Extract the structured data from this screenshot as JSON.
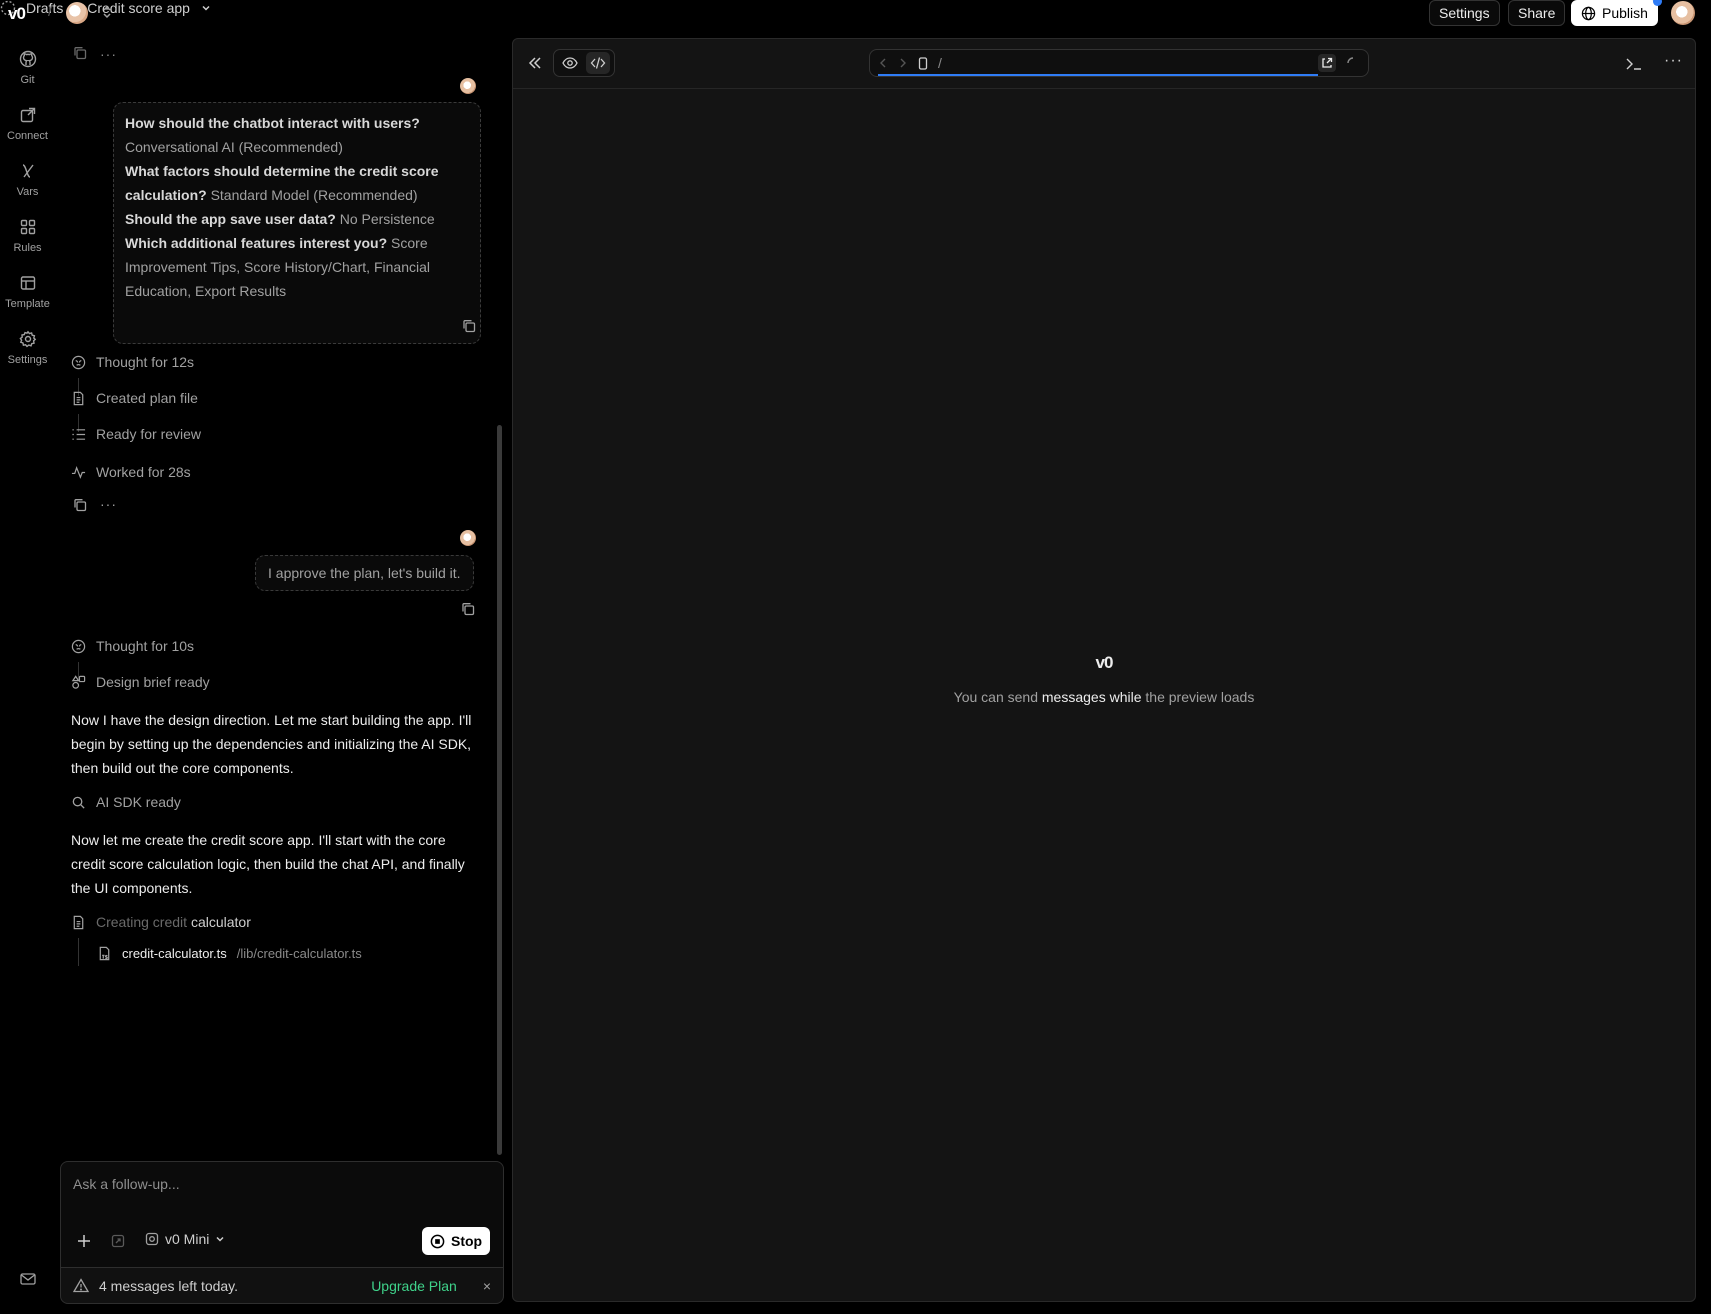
{
  "header": {
    "logo": "v0",
    "breadcrumb_drafts": "Drafts",
    "breadcrumb_separator": "/",
    "project_name": "Credit score app",
    "settings_label": "Settings",
    "share_label": "Share",
    "publish_label": "Publish"
  },
  "sidebar": {
    "items": [
      {
        "label": "Git",
        "icon": "github-icon"
      },
      {
        "label": "Connect",
        "icon": "connect-icon"
      },
      {
        "label": "Vars",
        "icon": "vars-icon"
      },
      {
        "label": "Rules",
        "icon": "rules-icon"
      },
      {
        "label": "Template",
        "icon": "template-icon"
      },
      {
        "label": "Settings",
        "icon": "gear-icon"
      }
    ]
  },
  "chat": {
    "answers": {
      "q1": "How should the chatbot interact with users?",
      "a1": "Conversational AI (Recommended)",
      "q2": "What factors should determine the credit score calculation?",
      "a2": "Standard Model (Recommended)",
      "q3": "Should the app save user data?",
      "a3": "No Persistence",
      "q4": "Which additional features interest you?",
      "a4": "Score Improvement Tips, Score History/Chart, Financial Education, Export Results"
    },
    "steps1": {
      "thought": "Thought for 12s",
      "plan": "Created plan file",
      "review": "Ready for review",
      "worked": "Worked for 28s"
    },
    "user_message": "I approve the plan, let's build it.",
    "steps2": {
      "thought": "Thought for 10s",
      "design": "Design brief ready"
    },
    "para1": "Now I have the design direction. Let me start building the app. I'll begin by setting up the dependencies and initializing the AI SDK, then build out the core components.",
    "sdk": "AI SDK ready",
    "para2": "Now let me create the credit score app. I'll start with the core credit score calculation logic, then build the chat API, and finally the UI components.",
    "creating_prefix": "Creating credit",
    "creating_suffix": "calculator",
    "file_name": "credit-calculator.ts",
    "file_path": "/lib/credit-calculator.ts"
  },
  "composer": {
    "placeholder": "Ask a follow-up...",
    "model": "v0 Mini",
    "stop_label": "Stop",
    "limit_text": "4 messages left today.",
    "upgrade_label": "Upgrade Plan",
    "close": "×"
  },
  "preview": {
    "url_path": "/",
    "logo": "v0",
    "msg_part1": "You can send",
    "msg_part2": "messages while",
    "msg_part3": "the preview loads"
  },
  "colors": {
    "accent_blue": "#2f7cf6",
    "upgrade_green": "#3fd28a",
    "background": "#000000",
    "panel": "#141414"
  }
}
